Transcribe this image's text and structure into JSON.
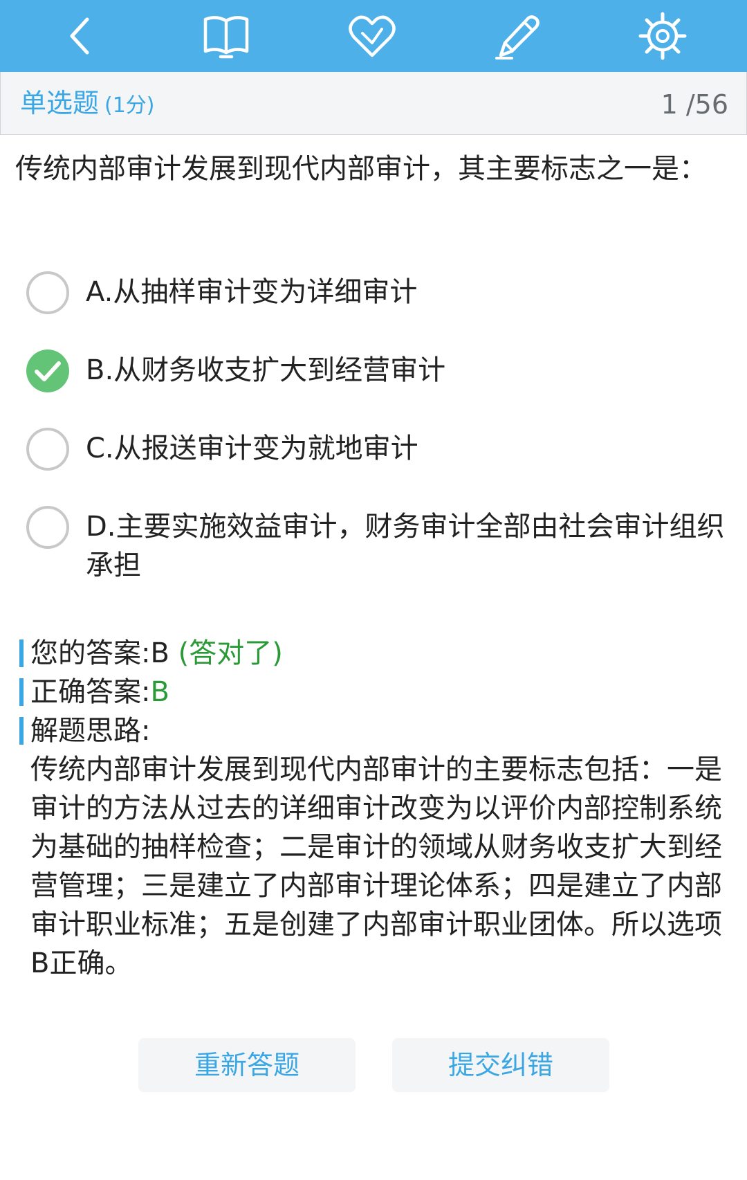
{
  "toolbar": {
    "background": "#4db0e8",
    "icons": [
      "back-icon",
      "book-icon",
      "heart-icon",
      "pencil-icon",
      "gear-icon"
    ]
  },
  "subheader": {
    "type_label": "单选题",
    "score_label": "(1分)",
    "counter": "1 /56"
  },
  "question": {
    "text": "传统内部审计发展到现代内部审计，其主要标志之一是："
  },
  "options": [
    {
      "text": "A.从抽样审计变为详细审计",
      "selected": false
    },
    {
      "text": "B.从财务收支扩大到经营审计",
      "selected": true
    },
    {
      "text": "C.从报送审计变为就地审计",
      "selected": false
    },
    {
      "text": "D.主要实施效益审计，财务审计全部由社会审计组织承担",
      "selected": false
    }
  ],
  "answer": {
    "your_label": "您的答案:",
    "your_value": "B",
    "your_status": "(答对了)",
    "correct_label": "正确答案:",
    "correct_value": "B",
    "explain_label": "解题思路:",
    "explanation": "传统内部审计发展到现代内部审计的主要标志包括：一是审计的方法从过去的详细审计改变为以评价内部控制系统为基础的抽样检查；二是审计的领域从财务收支扩大到经营管理；三是建立了内部审计理论体系；四是建立了内部审计职业标准；五是创建了内部审计职业团体。所以选项B正确。"
  },
  "buttons": {
    "retry": "重新答题",
    "report": "提交纠错"
  },
  "colors": {
    "accent": "#3aa7e4",
    "correct": "#2a9a36",
    "check": "#63c478"
  }
}
